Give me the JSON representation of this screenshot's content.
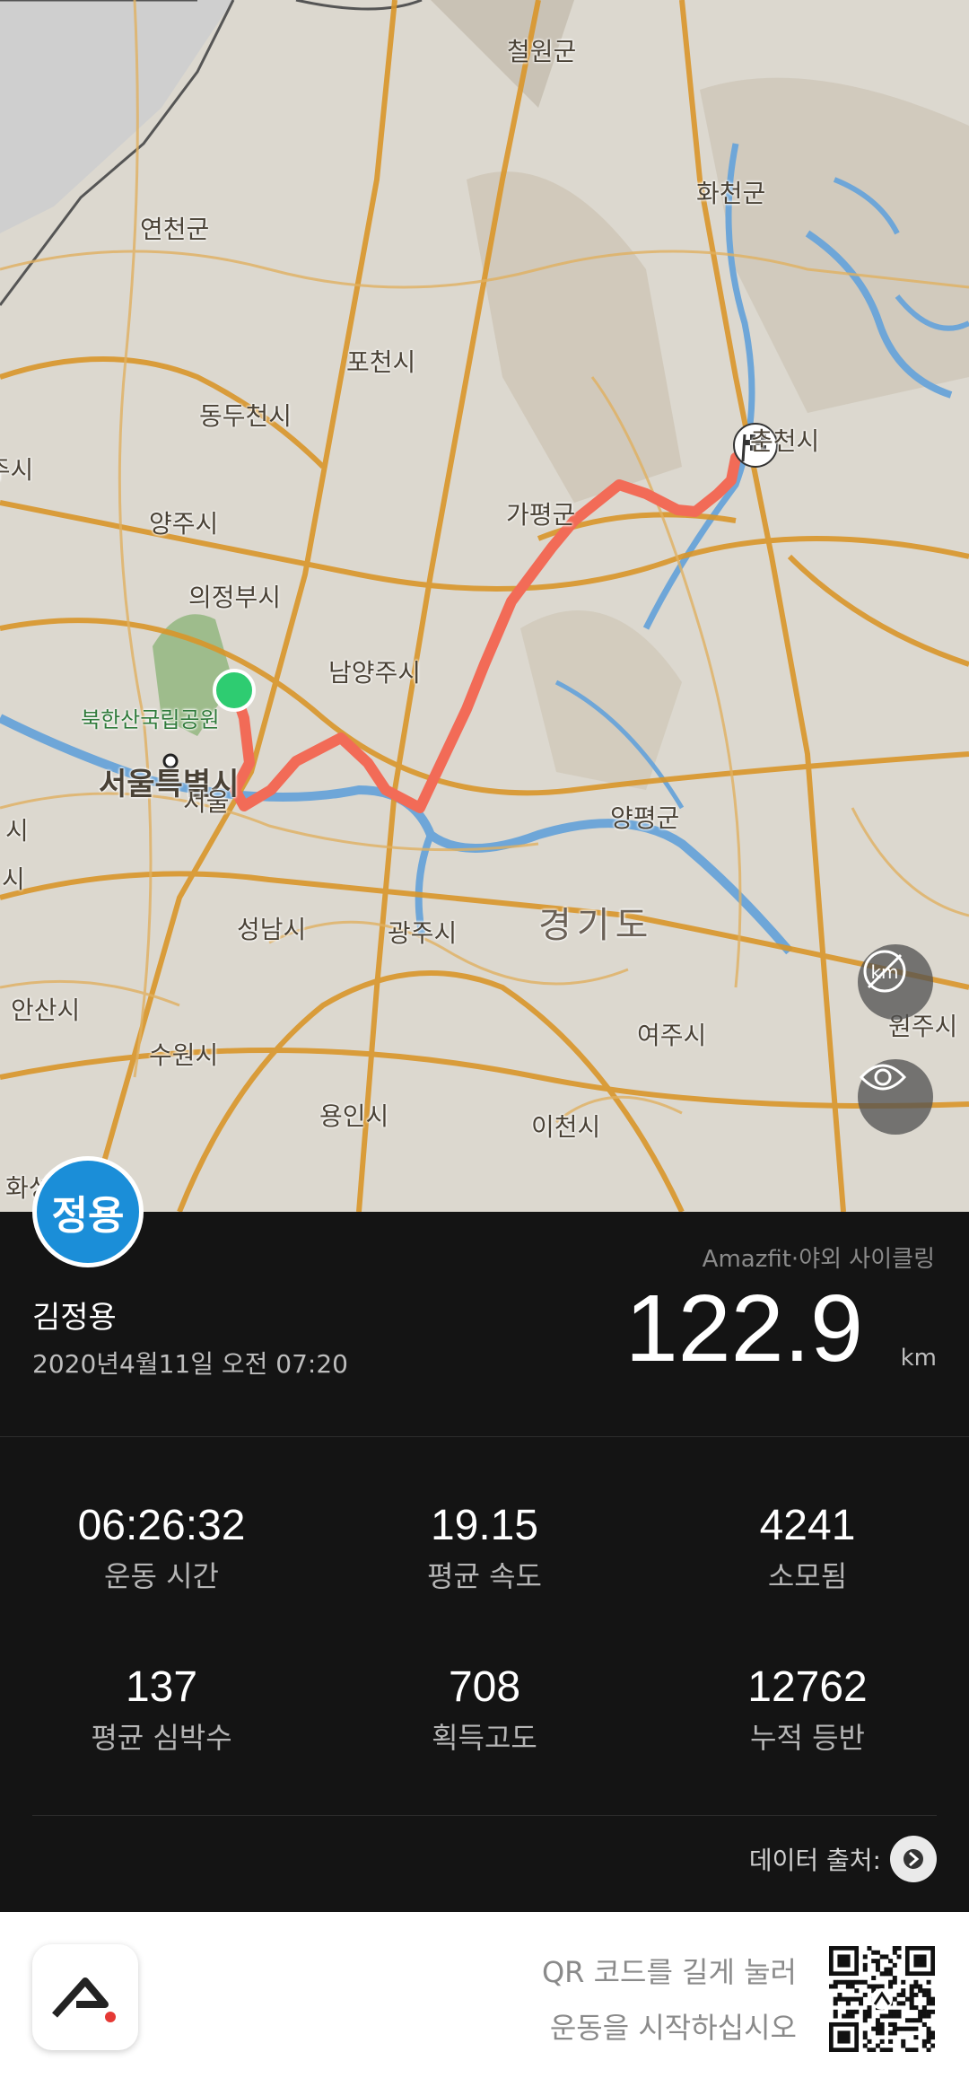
{
  "map": {
    "labels": {
      "cheorwon": "철원군",
      "hwacheon": "화천군",
      "yeoncheon": "연천군",
      "pocheon": "포천시",
      "dongducheon": "동두천시",
      "paju": "파주시",
      "yangju": "양주시",
      "uijeongbu": "의정부시",
      "gapyeong": "가평군",
      "chuncheon": "춘천시",
      "bukhansan": "북한산국립공원",
      "namyangju": "남양주시",
      "seoul_special": "서울특별시",
      "seoul": "서울",
      "yangpyeong": "양평군",
      "gyeonggi": "경기도",
      "seongnam": "성남시",
      "gwangju": "광주시",
      "ansan": "안산시",
      "suwon": "수원시",
      "yongin": "용인시",
      "icheon": "이천시",
      "yeoju": "여주시",
      "wonju": "원주시",
      "left_partial_1": "시",
      "left_partial_2": "시",
      "left_partial_3": "시",
      "hwaseong_partial": "화성"
    },
    "route_color": "#f26b57",
    "start_color": "#2ecc71",
    "buttons": {
      "km_toggle": "km",
      "visibility": "eye"
    }
  },
  "profile": {
    "avatar_text": "정용",
    "name": "김정용",
    "datetime": "2020년4월11일 오전 07:20"
  },
  "activity": {
    "source": "Amazfit·야외 사이클링",
    "distance": "122.9",
    "distance_unit": "km"
  },
  "stats": [
    {
      "value": "06:26:32",
      "label": "운동 시간"
    },
    {
      "value": "19.15",
      "label": "평균 속도"
    },
    {
      "value": "4241",
      "label": "소모됨"
    },
    {
      "value": "137",
      "label": "평균 심박수"
    },
    {
      "value": "708",
      "label": "획득고도"
    },
    {
      "value": "12762",
      "label": "누적 등반"
    }
  ],
  "data_source_label": "데이터 출처:",
  "footer": {
    "qr_line1": "QR 코드를 길게 눌러",
    "qr_line2": "운동을 시작하십시오"
  }
}
